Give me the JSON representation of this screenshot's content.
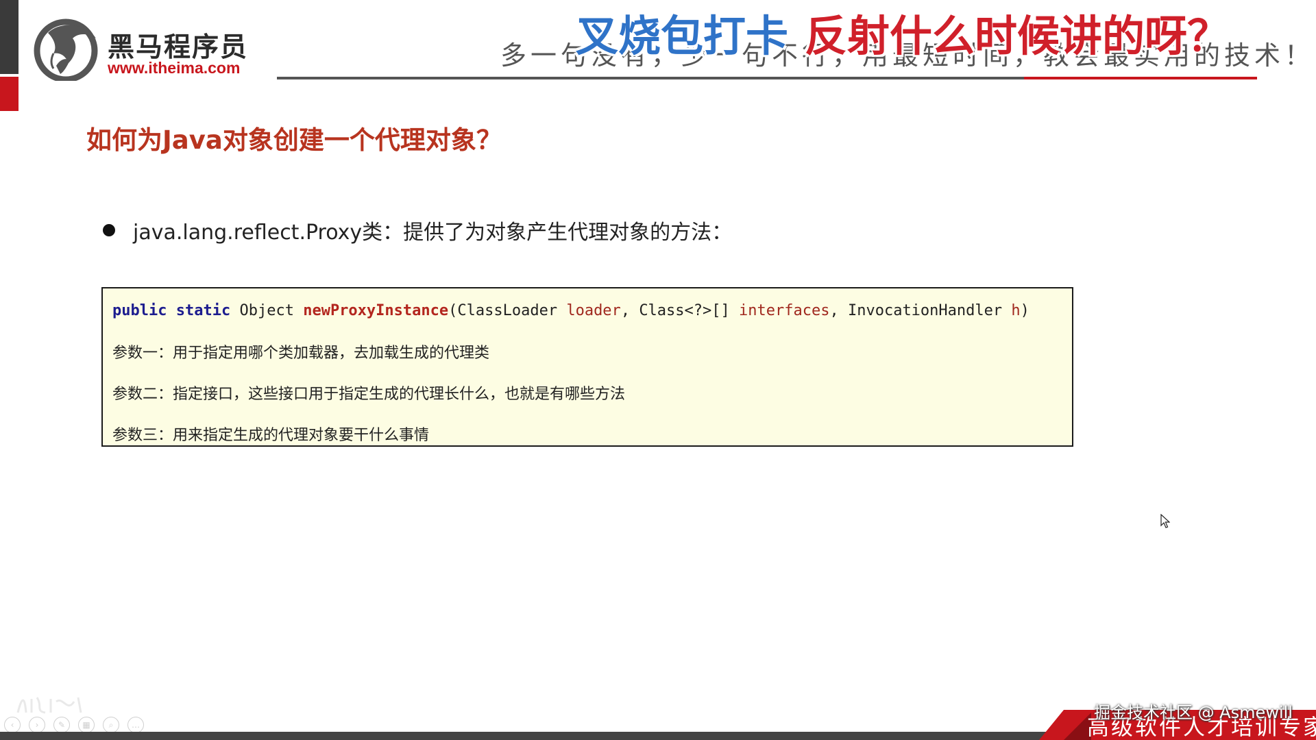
{
  "header": {
    "brand_name": "黑马程序员",
    "brand_url": "www.itheima.com",
    "slogan": "多一句没有，少一句不行，用最短时间，教会最实用的技术！",
    "overlay_part1": "叉烧包打卡",
    "overlay_part2": "反射什么时候讲的呀？"
  },
  "slide": {
    "title": "如何为Java对象创建一个代理对象？",
    "bullet": "java.lang.reflect.Proxy类：提供了为对象产生代理对象的方法：",
    "code": {
      "kw_public": "public",
      "kw_static": "static",
      "return_type": "Object",
      "method": "newProxyInstance",
      "open": "(",
      "type1": "ClassLoader",
      "name1": "loader",
      "sep1": ", ",
      "type2": "Class<?>[]",
      "name2": "interfaces",
      "sep2": ", ",
      "type3": "InvocationHandler",
      "name3": "h",
      "close": ")"
    },
    "params": [
      "参数一：用于指定用哪个类加载器，去加载生成的代理类",
      "参数二：指定接口，这些接口用于指定生成的代理长什么，也就是有哪些方法",
      "参数三：用来指定生成的代理对象要干什么事情"
    ]
  },
  "footer": {
    "watermark": "掘金技术社区 @ Asmewill",
    "tagline": "高级软件人才培训专家"
  },
  "colors": {
    "brand_red": "#c8161d",
    "title_red": "#b8341f",
    "overlay_blue": "#2f73c8",
    "keyword_navy": "#1d1d8f",
    "code_bg": "#fdfde3"
  },
  "icons": {
    "logo": "horse-logo-icon",
    "cursor": "mouse-pointer-icon",
    "controls": [
      "previous-icon",
      "next-icon",
      "pen-icon",
      "slides-icon",
      "zoom-icon",
      "more-icon"
    ]
  }
}
